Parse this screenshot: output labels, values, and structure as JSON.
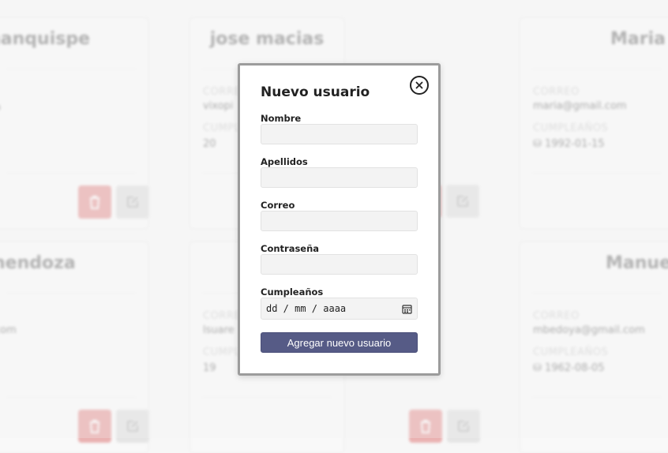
{
  "background_cards": [
    {
      "name": "amanquispe",
      "correo_label": "",
      "correo": "o",
      "cumple_label": "",
      "cumple": "",
      "show_buttons": true
    },
    {
      "name": "jose macias",
      "correo_label": "CORREO",
      "correo": "vixopi",
      "cumple_label": "CUMPLEAÑOS",
      "cumple": "20",
      "show_buttons": true
    },
    {
      "name": "Maria I",
      "correo_label": "CORREO",
      "correo": "maria@gmail.com",
      "cumple_label": "CUMPLEAÑOS",
      "cumple": "1992-01-15",
      "show_buttons": true
    },
    {
      "name": "nendoza",
      "correo_label": "",
      "correo": "com",
      "cumple_label": "",
      "cumple": "",
      "show_buttons": true
    },
    {
      "name": "",
      "correo_label": "CORREO",
      "correo": "lsuare",
      "cumple_label": "CUMPLEAÑOS",
      "cumple": "19",
      "show_buttons": true
    },
    {
      "name": "Manuel",
      "correo_label": "CORREO",
      "correo": "mbedoya@gmail.com",
      "cumple_label": "CUMPLEAÑOS",
      "cumple": "1962-08-05",
      "show_buttons": false
    }
  ],
  "modal": {
    "title": "Nuevo usuario",
    "close_icon": "close-circle-icon",
    "fields": {
      "nombre": {
        "label": "Nombre",
        "value": "",
        "placeholder": ""
      },
      "apellidos": {
        "label": "Apellidos",
        "value": "",
        "placeholder": ""
      },
      "correo": {
        "label": "Correo",
        "value": "",
        "placeholder": ""
      },
      "contrasena": {
        "label": "Contraseña",
        "value": "",
        "placeholder": ""
      },
      "cumpleanos": {
        "label": "Cumpleaños",
        "value": "dd / mm / aaaa"
      }
    },
    "submit_label": "Agregar nuevo usuario"
  },
  "colors": {
    "submit_bg": "#565b86",
    "delete_btn": "#e07a7a",
    "edit_btn": "#d7d7d7",
    "modal_border": "#9c9c9c"
  }
}
